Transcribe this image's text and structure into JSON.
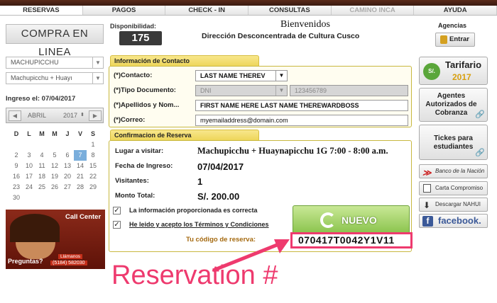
{
  "tabs": [
    "RESERVAS",
    "PAGOS",
    "CHECK - IN",
    "CONSULTAS",
    "CAMINO INCA",
    "AYUDA"
  ],
  "left": {
    "compra_title": "COMPRA EN LINEA",
    "select_place": "MACHUPICCHU",
    "select_route": "Machupicchu + Huayı",
    "ingreso": "Ingreso el: 07/04/2017",
    "calendar": {
      "month": "ABRIL",
      "year": "2017",
      "weekdays": [
        "D",
        "L",
        "M",
        "M",
        "J",
        "V",
        "S"
      ],
      "rows": [
        [
          "",
          "",
          "",
          "",
          "",
          "",
          "1"
        ],
        [
          "2",
          "3",
          "4",
          "5",
          "6",
          "7",
          "8"
        ],
        [
          "9",
          "10",
          "11",
          "12",
          "13",
          "14",
          "15"
        ],
        [
          "16",
          "17",
          "18",
          "19",
          "20",
          "21",
          "22"
        ],
        [
          "23",
          "24",
          "25",
          "26",
          "27",
          "28",
          "29"
        ],
        [
          "30",
          "",
          "",
          "",
          "",
          "",
          ""
        ]
      ],
      "selected": "7"
    },
    "call_center": "Call Center",
    "preguntas": "Preguntas?",
    "llamanos": "Llámanos",
    "phone": "(5184) 582030"
  },
  "header": {
    "disponibilidad_label": "Disponibilidad:",
    "disponibilidad_value": "175",
    "bienvenidos": "Bienvenidos",
    "direccion": "Dirección Desconcentrada de Cultura Cusco"
  },
  "contacto": {
    "title": "Información de Contacto",
    "contacto_label": "(*)Contacto:",
    "contacto_value": "LAST NAME THEREV",
    "tipo_label": "(*)Tipo Documento:",
    "tipo_value": "DNI",
    "doc_number": "123456789",
    "apellidos_label": "(*)Apellidos y Nom...",
    "apellidos_value": "FIRST NAME HERE LAST NAME THEREWARDBOSS",
    "correo_label": "(*)Correo:",
    "correo_value": "myemailaddress@domain.com"
  },
  "confirmacion": {
    "title": "Confirmacion de Reserva",
    "lugar_label": "Lugar a visitar:",
    "lugar_value": "Machupicchu + Huaynapicchu 1G 7:00 - 8:00 a.m.",
    "fecha_label": "Fecha de Ingreso:",
    "fecha_value": "07/04/2017",
    "visitantes_label": "Visitantes:",
    "visitantes_value": "1",
    "monto_label": "Monto Total:",
    "monto_value": "S/. 200.00",
    "check1": "La información proporcionada es correcta",
    "check2": "He leido y acepto los Términos y Condiciones",
    "nuevo": "NUEVO",
    "codigo_label": "Tu código de reserva:",
    "codigo_value": "070417T0042Y1V11"
  },
  "annotation": "Reservation #",
  "right": {
    "agencias": "Agencias",
    "entrar": "Entrar",
    "tarifario": "Tarifario",
    "tarifario_year": "2017",
    "agentes": "Agentes Autorizados de Cobranza",
    "tickes": "Tickes para estudiantes",
    "banco": "Banco de la Nación",
    "carta": "Carta Compromiso",
    "descargar": "Descargar NAHUI",
    "facebook": "facebook."
  },
  "colors": {
    "accent_pink": "#ee3a6e",
    "section_yellow": "#eed65a",
    "nuevo_green": "#88c24a"
  }
}
